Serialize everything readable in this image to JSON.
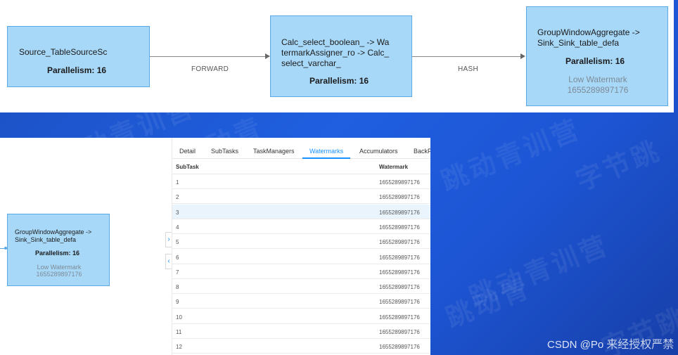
{
  "top_dag": {
    "nodes": [
      {
        "id": "source",
        "label": "Source_TableSourceSc",
        "parallelism": "Parallelism: 16"
      },
      {
        "id": "calc",
        "label_lines": [
          "Calc_select_boolean_ -> Wa",
          "termarkAssigner_ro -> Calc_",
          "select_varchar_"
        ],
        "parallelism": "Parallelism: 16"
      },
      {
        "id": "agg",
        "label_lines": [
          "GroupWindowAggregate ->",
          "Sink_Sink_table_defa"
        ],
        "parallelism": "Parallelism: 16",
        "watermark_label": "Low Watermark",
        "watermark_value": "1655289897176"
      }
    ],
    "edges": [
      {
        "label": "FORWARD"
      },
      {
        "label": "HASH"
      }
    ]
  },
  "left_dag": {
    "node": {
      "label_lines": [
        "GroupWindowAggregate ->",
        "Sink_Sink_table_defa"
      ],
      "parallelism": "Parallelism: 16",
      "watermark_label": "Low Watermark",
      "watermark_value": "1655289897176"
    }
  },
  "tabs": [
    "Detail",
    "SubTasks",
    "TaskManagers",
    "Watermarks",
    "Accumulators",
    "BackP"
  ],
  "active_tab": "Watermarks",
  "table": {
    "headers": [
      "SubTask",
      "Watermark"
    ],
    "rows": [
      [
        "1",
        "1655289897176"
      ],
      [
        "2",
        "1655289897176"
      ],
      [
        "3",
        "1655289897176"
      ],
      [
        "4",
        "1655289897176"
      ],
      [
        "5",
        "1655289897176"
      ],
      [
        "6",
        "1655289897176"
      ],
      [
        "7",
        "1655289897176"
      ],
      [
        "8",
        "1655289897176"
      ],
      [
        "9",
        "1655289897176"
      ],
      [
        "10",
        "1655289897176"
      ],
      [
        "11",
        "1655289897176"
      ],
      [
        "12",
        "1655289897176"
      ]
    ],
    "selected_row": "3"
  },
  "watermark_text": [
    "字节跳动青训营",
    "跳动青",
    "跳动青训营",
    "字节跳",
    "跳动青",
    "跳动青训营",
    "字节跳动"
  ],
  "footer_credit": "CSDN @Po",
  "footer_overlay": "来经授权严禁",
  "colors": {
    "accent": "#1890ff",
    "node_fill": "#a8d8f8",
    "node_border": "#5aa9e6",
    "selected_row": "#e9f4fd"
  }
}
